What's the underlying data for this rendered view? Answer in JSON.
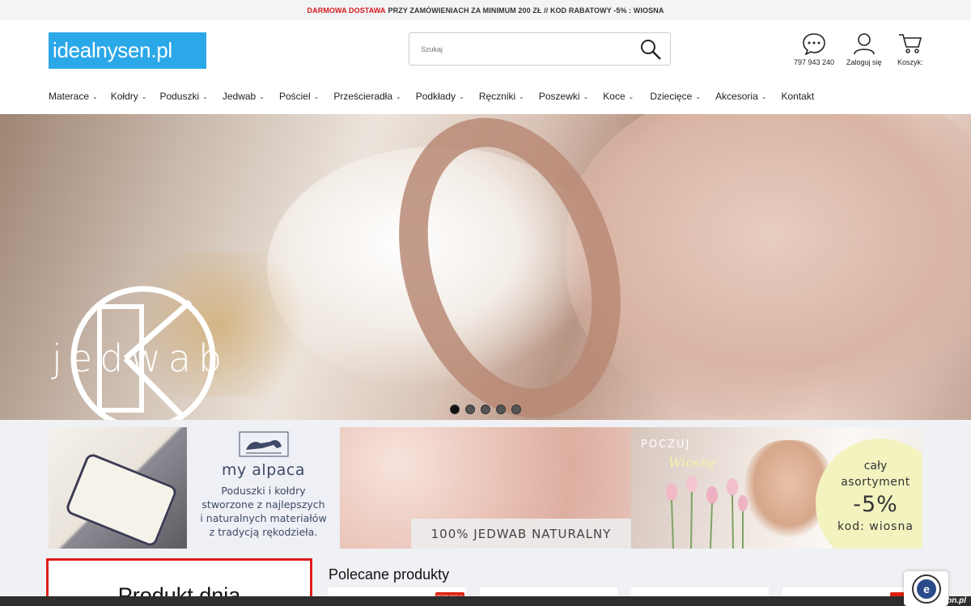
{
  "topbar": {
    "highlight": "DARMOWA DOSTAWA",
    "text": "PRZY ZAMÓWIENIACH ZA MINIMUM 200 ZŁ // KOD RABATOWY -5% : WIOSNA"
  },
  "header": {
    "logo": "idealnysen.pl",
    "search_placeholder": "Szukaj",
    "phone": "797 943 240",
    "login": "Zaloguj się",
    "cart": "Koszyk:"
  },
  "nav": {
    "items": [
      {
        "label": "Materace"
      },
      {
        "label": "Kołdry"
      },
      {
        "label": "Poduszki"
      },
      {
        "label": "Jedwab"
      },
      {
        "label": "Pościel"
      },
      {
        "label": "Prześcieradła"
      },
      {
        "label": "Podkłady"
      },
      {
        "label": "Ręczniki"
      },
      {
        "label": "Poszewki"
      },
      {
        "label": "Koce"
      },
      {
        "label": "Dziecięce"
      },
      {
        "label": "Akcesoria"
      },
      {
        "label": "Kontakt"
      }
    ]
  },
  "hero": {
    "word": "jedwab",
    "slides": 5,
    "active_slide": 1
  },
  "banners": {
    "alpaca": {
      "brand": "my alpaca",
      "line1": "Poduszki i kołdry",
      "line2": "stworzone z najlepszych",
      "line3": "i naturalnych materiałów",
      "line4": "z tradycją rękodzieła."
    },
    "silk": {
      "caption": "100% JEDWAB NATURALNY"
    },
    "spring": {
      "poczuj": "POCZUJ",
      "wiosne": "Wiosnę",
      "line1": "cały",
      "line2": "asortyment",
      "line3": "-5%",
      "line4": "kod: wiosna"
    }
  },
  "sections": {
    "produkt_dnia": "Produkt dnia",
    "polecane": "Polecane produkty",
    "badge": "PROMOCJA"
  },
  "watermark": "www.tcbn.pl",
  "colors": {
    "accent": "#2aa8e8",
    "red": "#d11a1a"
  }
}
